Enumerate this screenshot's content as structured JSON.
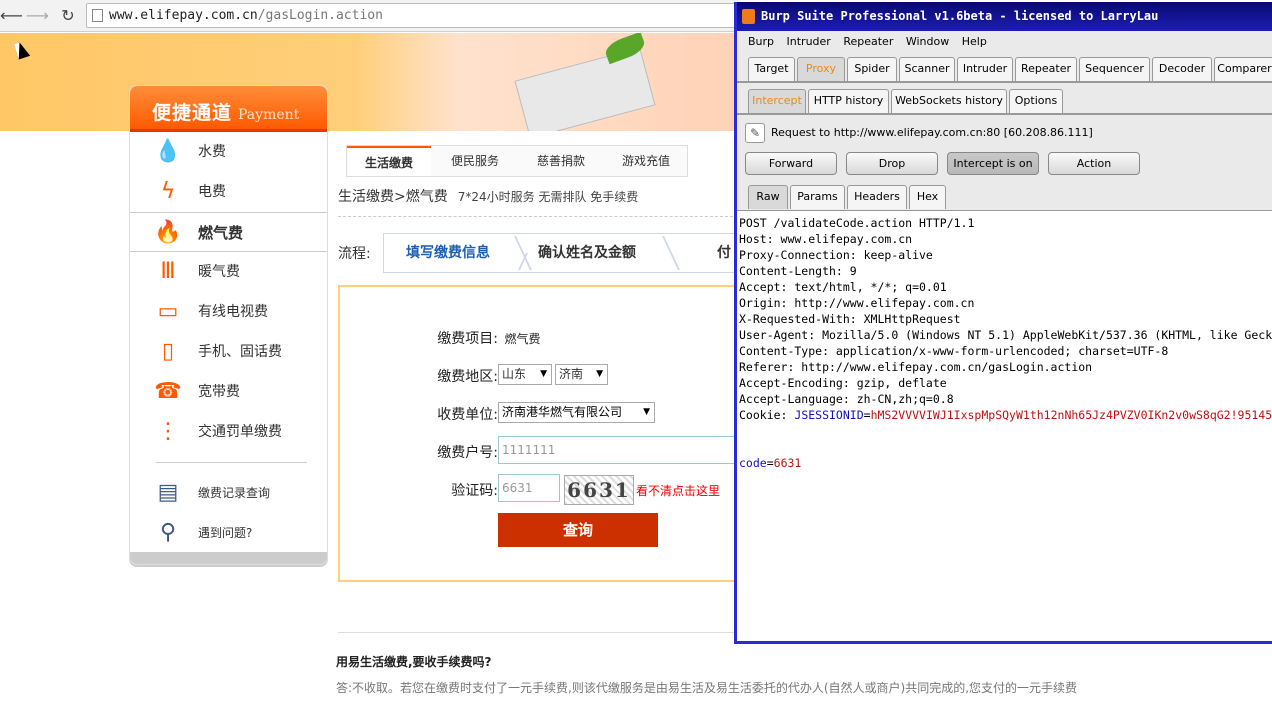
{
  "browser": {
    "url_host": "www.elifepay.com.cn",
    "url_path": "/gasLogin.action"
  },
  "sidebar": {
    "title_cn": "便捷通道",
    "title_en": "Payment",
    "items": [
      {
        "label": "水费",
        "icon": "water-drop-icon",
        "glyph": "💧"
      },
      {
        "label": "电费",
        "icon": "lightning-icon",
        "glyph": "ϟ"
      },
      {
        "label": "燃气费",
        "icon": "flame-icon",
        "glyph": "🔥"
      },
      {
        "label": "暖气费",
        "icon": "radiator-icon",
        "glyph": "Ⅲ"
      },
      {
        "label": "有线电视费",
        "icon": "tv-icon",
        "glyph": "▭"
      },
      {
        "label": "手机、固话费",
        "icon": "mobile-phone-icon",
        "glyph": "▯"
      },
      {
        "label": "宽带费",
        "icon": "telephone-icon",
        "glyph": "☎"
      },
      {
        "label": "交通罚单缴费",
        "icon": "traffic-light-icon",
        "glyph": "⋮"
      }
    ],
    "extra": [
      {
        "label": "缴费记录查询",
        "icon": "record-icon",
        "glyph": "▤"
      },
      {
        "label": "遇到问题?",
        "icon": "magnifier-icon",
        "glyph": "⚲"
      }
    ]
  },
  "tabs": [
    "生活缴费",
    "便民服务",
    "慈善捐款",
    "游戏充值"
  ],
  "breadcrumb": {
    "path": "生活缴费>燃气费",
    "sub": "7*24小时服务 无需排队 免手续费"
  },
  "flow": {
    "label": "流程:",
    "steps": [
      "填写缴费信息",
      "确认姓名及金额",
      "付"
    ]
  },
  "form": {
    "item_label": "缴费项目:",
    "item_value": "燃气费",
    "region_label": "缴费地区:",
    "province": "山东",
    "city": "济南",
    "unit_label": "收费单位:",
    "unit": "济南港华燃气有限公司",
    "account_label": "缴费户号:",
    "account_value": "1111111",
    "captcha_label": "验证码:",
    "captcha_value": "6631",
    "captcha_image_text": "6631",
    "captcha_link": "看不清点击这里",
    "submit": "查询"
  },
  "faq": {
    "question": "用易生活缴费,要收手续费吗?",
    "answer": "答:不收取。若您在缴费时支付了一元手续费,则该代缴服务是由易生活及易生活委托的代办人(自然人或商户)共同完成的,您支付的一元手续费"
  },
  "burp": {
    "title": "Burp Suite Professional v1.6beta - licensed to LarryLau",
    "menu": [
      "Burp",
      "Intruder",
      "Repeater",
      "Window",
      "Help"
    ],
    "main_tabs": [
      "Target",
      "Proxy",
      "Spider",
      "Scanner",
      "Intruder",
      "Repeater",
      "Sequencer",
      "Decoder",
      "Comparer"
    ],
    "proxy_tabs": [
      "Intercept",
      "HTTP history",
      "WebSockets history",
      "Options"
    ],
    "request_info": "Request to http://www.elifepay.com.cn:80  [60.208.86.111]",
    "buttons": [
      "Forward",
      "Drop",
      "Intercept is on",
      "Action"
    ],
    "view_tabs": [
      "Raw",
      "Params",
      "Headers",
      "Hex"
    ],
    "request_lines": [
      "POST /validateCode.action HTTP/1.1",
      "Host: www.elifepay.com.cn",
      "Proxy-Connection: keep-alive",
      "Content-Length: 9",
      "Accept: text/html, */*; q=0.01",
      "Origin: http://www.elifepay.com.cn",
      "X-Requested-With: XMLHttpRequest",
      "User-Agent: Mozilla/5.0 (Windows NT 5.1) AppleWebKit/537.36 (KHTML, like Geck",
      "Content-Type: application/x-www-form-urlencoded; charset=UTF-8",
      "Referer: http://www.elifepay.com.cn/gasLogin.action",
      "Accept-Encoding: gzip, deflate",
      "Accept-Language: zh-CN,zh;q=0.8"
    ],
    "cookie_prefix": "Cookie: ",
    "cookie_name": "JSESSIONID",
    "cookie_eq": "=",
    "cookie_value": "hMS2VVVVIWJ1IxspMpSQyW1th12nNh65Jz4PVZV0IKn2v0wS8qG2!95145",
    "body_name": "code",
    "body_eq": "=",
    "body_value": "6631"
  }
}
